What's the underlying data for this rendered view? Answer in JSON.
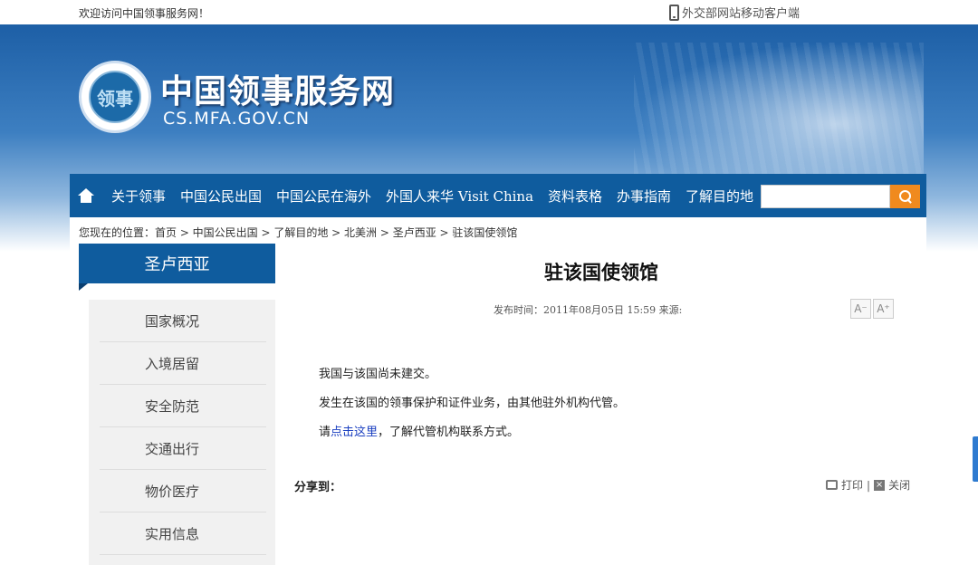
{
  "topbar": {
    "welcome": "欢迎访问中国领事服务网！",
    "mobile_link": "外交部网站移动客户端"
  },
  "header": {
    "logo_text": "领事",
    "title": "中国领事服务网",
    "domain": "CS.MFA.GOV.CN"
  },
  "nav": {
    "items": [
      "关于领事",
      "中国公民出国",
      "中国公民在海外",
      "外国人来华 Visit China",
      "资料表格",
      "办事指南",
      "了解目的地"
    ],
    "search_placeholder": ""
  },
  "breadcrumb": "您现在的位置：首页 > 中国公民出国 > 了解目的地 > 北美洲 > 圣卢西亚 > 驻该国使领馆",
  "sidebar": {
    "heading": "圣卢西亚",
    "items": [
      "国家概况",
      "入境居留",
      "安全防范",
      "交通出行",
      "物价医疗",
      "实用信息"
    ]
  },
  "article": {
    "title": "驻该国使领馆",
    "meta": "发布时间：2011年08月05日 15:59 来源:",
    "font_decrease": "A⁻",
    "font_increase": "A⁺",
    "para1": "我国与该国尚未建交。",
    "para2": "发生在该国的领事保护和证件业务，由其他驻外机构代管。",
    "para3_prefix": "请",
    "para3_link": "点击这里",
    "para3_suffix": "，了解代管机构联系方式。",
    "share_label": "分享到：",
    "print_label": "打印",
    "close_label": "关闭"
  }
}
